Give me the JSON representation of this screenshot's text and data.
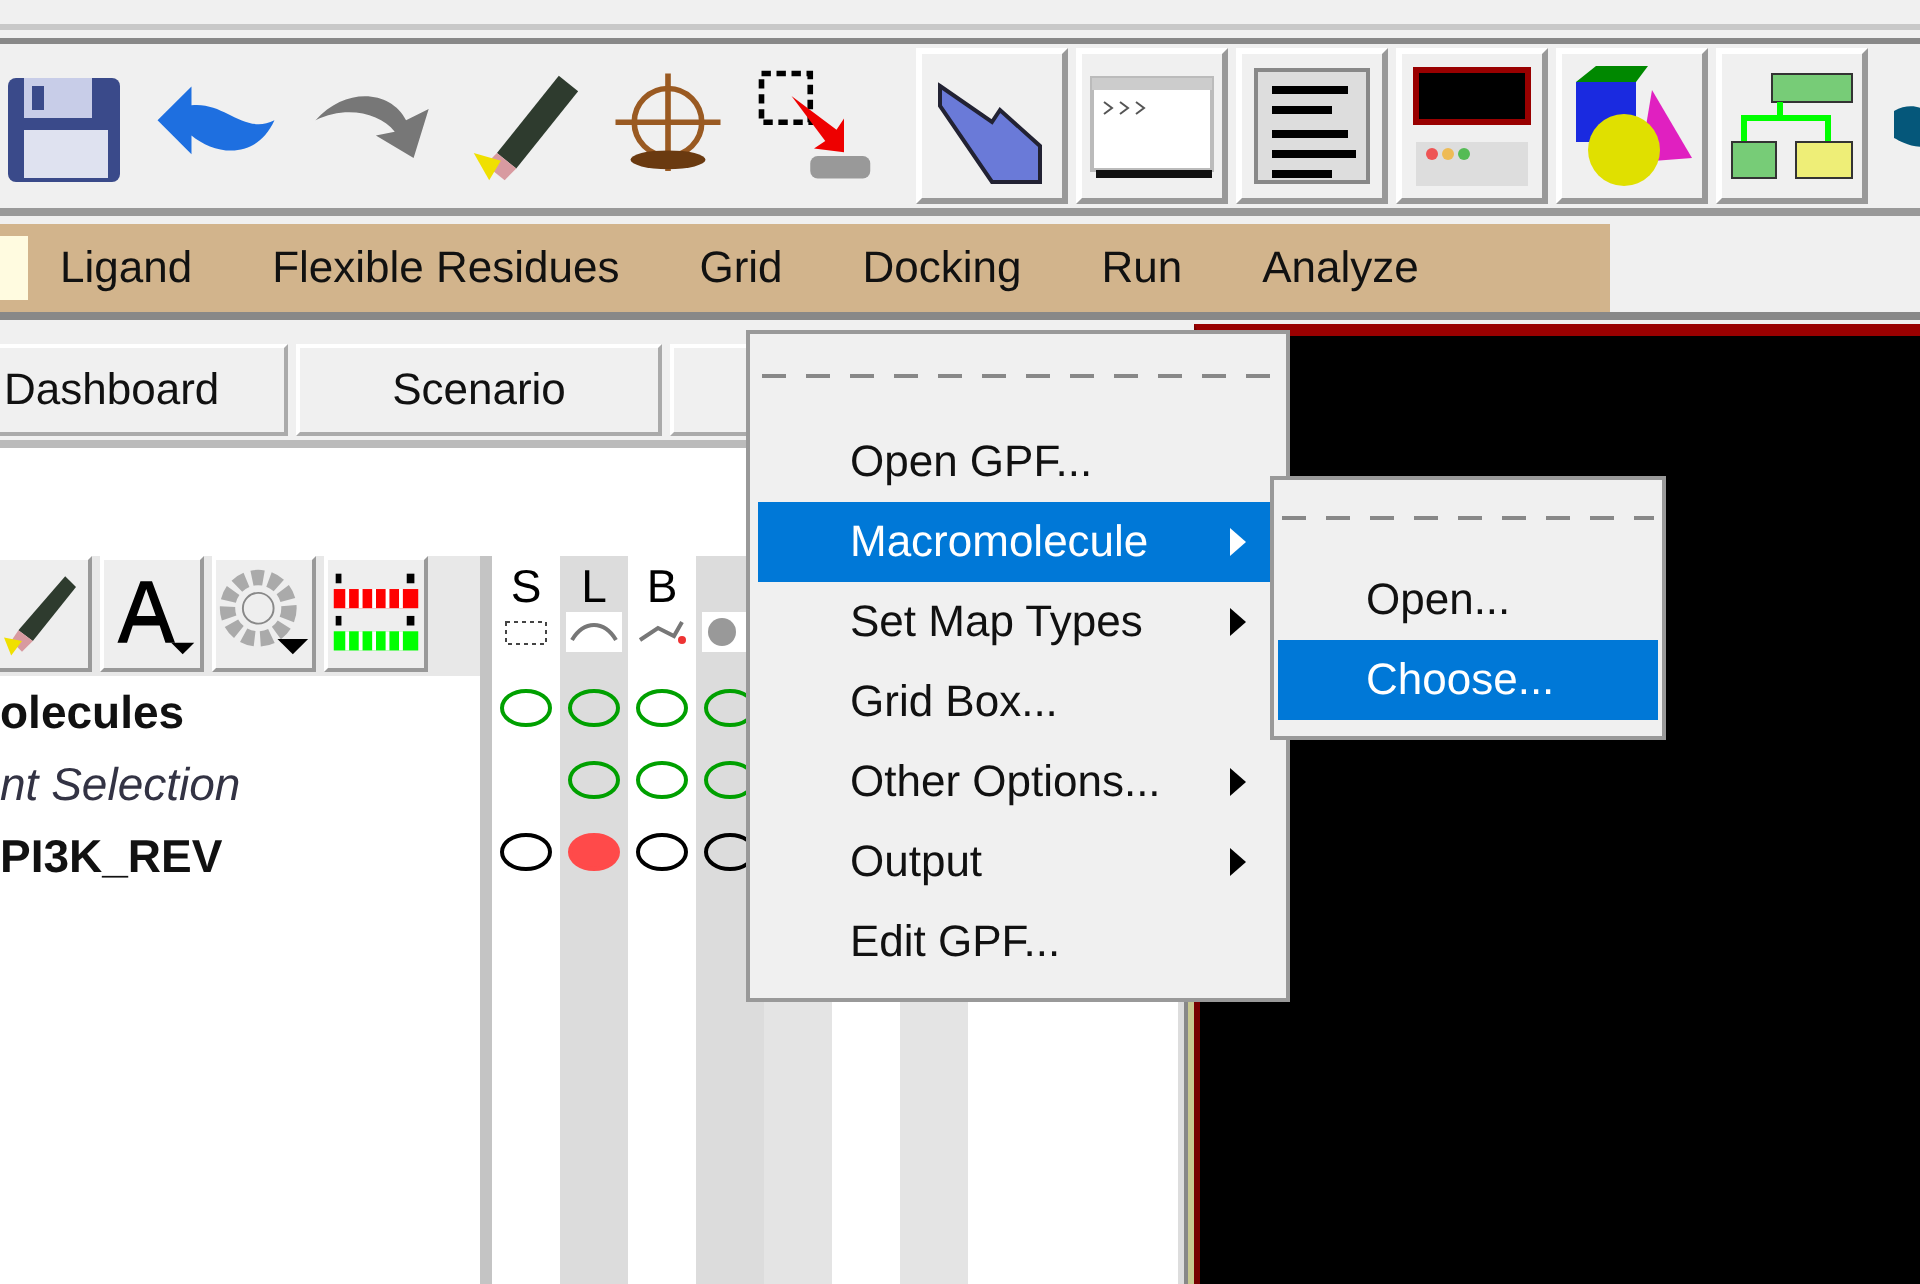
{
  "menubar": [
    {
      "label": "Ligand"
    },
    {
      "label": "Flexible Residues"
    },
    {
      "label": "Grid"
    },
    {
      "label": "Docking"
    },
    {
      "label": "Run"
    },
    {
      "label": "Analyze"
    }
  ],
  "tabs": [
    {
      "label": "Dashboard"
    },
    {
      "label": "Scenario"
    }
  ],
  "dashboard": {
    "columns": [
      "S",
      "L",
      "B"
    ],
    "rows": [
      {
        "label": "olecules",
        "kind": "group",
        "marks": [
          {
            "kind": "outline",
            "color": "#00a000"
          },
          {
            "kind": "outline",
            "color": "#00a000"
          },
          {
            "kind": "outline",
            "color": "#00a000"
          },
          {
            "kind": "outline",
            "color": "#00a000"
          }
        ]
      },
      {
        "label": "nt Selection",
        "kind": "selection",
        "marks": [
          {
            "kind": "empty"
          },
          {
            "kind": "outline",
            "color": "#00a000"
          },
          {
            "kind": "outline",
            "color": "#00a000"
          },
          {
            "kind": "outline",
            "color": "#00a000"
          }
        ]
      },
      {
        "label": "PI3K_REV",
        "kind": "molecule",
        "marks": [
          {
            "kind": "outline",
            "color": "#000000"
          },
          {
            "kind": "filled",
            "color": "#ff4a4a"
          },
          {
            "kind": "outline",
            "color": "#000000"
          },
          {
            "kind": "outline",
            "color": "#000000"
          }
        ]
      }
    ]
  },
  "grid_menu": {
    "items": [
      {
        "label": "Open GPF...",
        "submenu": false,
        "selected": false
      },
      {
        "label": "Macromolecule",
        "submenu": true,
        "selected": true
      },
      {
        "label": "Set Map Types",
        "submenu": true,
        "selected": false
      },
      {
        "label": "Grid Box...",
        "submenu": false,
        "selected": false
      },
      {
        "label": "Other Options...",
        "submenu": true,
        "selected": false
      },
      {
        "label": "Output",
        "submenu": true,
        "selected": false
      },
      {
        "label": "Edit GPF...",
        "submenu": false,
        "selected": false
      }
    ]
  },
  "submenu": {
    "items": [
      {
        "label": "Open...",
        "selected": false
      },
      {
        "label": "Choose...",
        "selected": true
      }
    ]
  }
}
